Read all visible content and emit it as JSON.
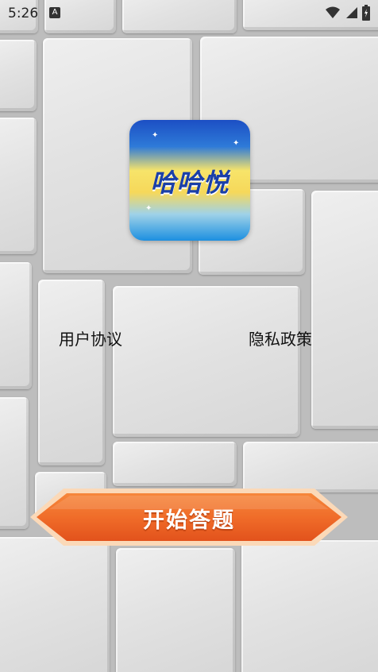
{
  "status_bar": {
    "time": "5:26",
    "notification_badge": "A",
    "icons": [
      "wifi-icon",
      "signal-icon",
      "battery-icon"
    ]
  },
  "app": {
    "logo_text": "哈哈悦"
  },
  "links": {
    "user_agreement": "用户协议",
    "privacy_policy": "隐私政策"
  },
  "start_button": {
    "label": "开始答题"
  },
  "colors": {
    "button_orange": "#ee6a2a",
    "button_border": "#fbd9b8",
    "logo_blue": "#1a3fa8"
  }
}
